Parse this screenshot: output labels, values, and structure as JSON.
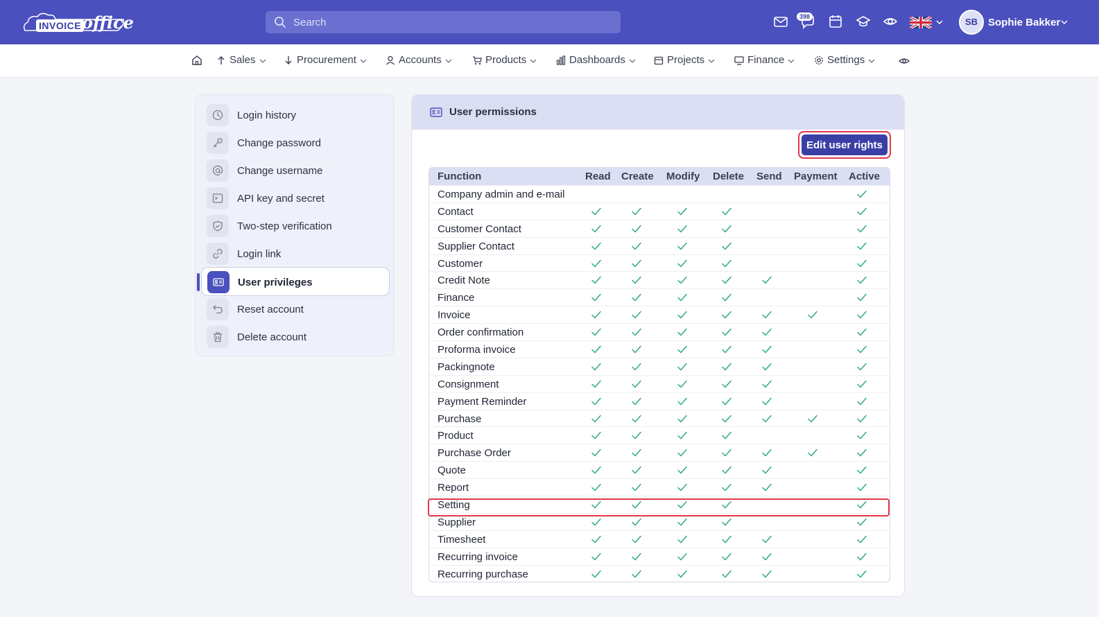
{
  "header": {
    "logo_text_box": "INVOICE",
    "logo_text_script": "office",
    "search_placeholder": "Search",
    "notification_count": "398",
    "user_initials": "SB",
    "user_name": "Sophie Bakker"
  },
  "nav": {
    "items": [
      {
        "label": "Sales"
      },
      {
        "label": "Procurement"
      },
      {
        "label": "Accounts"
      },
      {
        "label": "Products"
      },
      {
        "label": "Dashboards"
      },
      {
        "label": "Projects"
      },
      {
        "label": "Finance"
      },
      {
        "label": "Settings"
      }
    ]
  },
  "sidebar": {
    "items": [
      {
        "label": "Login history",
        "icon": "clock-icon"
      },
      {
        "label": "Change password",
        "icon": "key-icon"
      },
      {
        "label": "Change username",
        "icon": "at-icon"
      },
      {
        "label": "API key and secret",
        "icon": "terminal-icon"
      },
      {
        "label": "Two-step verification",
        "icon": "shield-icon"
      },
      {
        "label": "Login link",
        "icon": "link-icon"
      },
      {
        "label": "User privileges",
        "icon": "id-card-icon",
        "active": true
      },
      {
        "label": "Reset account",
        "icon": "undo-icon"
      },
      {
        "label": "Delete account",
        "icon": "trash-icon"
      }
    ]
  },
  "panel": {
    "title": "User permissions",
    "edit_button": "Edit user rights"
  },
  "table": {
    "columns": [
      "Function",
      "Read",
      "Create",
      "Modify",
      "Delete",
      "Send",
      "Payment",
      "Active"
    ],
    "highlighted_row": "Setting",
    "rows": [
      {
        "function": "Company admin and e-mail",
        "read": false,
        "create": false,
        "modify": false,
        "delete": false,
        "send": false,
        "payment": false,
        "active": true
      },
      {
        "function": "Contact",
        "read": true,
        "create": true,
        "modify": true,
        "delete": true,
        "send": false,
        "payment": false,
        "active": true
      },
      {
        "function": "Customer Contact",
        "read": true,
        "create": true,
        "modify": true,
        "delete": true,
        "send": false,
        "payment": false,
        "active": true
      },
      {
        "function": "Supplier Contact",
        "read": true,
        "create": true,
        "modify": true,
        "delete": true,
        "send": false,
        "payment": false,
        "active": true
      },
      {
        "function": "Customer",
        "read": true,
        "create": true,
        "modify": true,
        "delete": true,
        "send": false,
        "payment": false,
        "active": true
      },
      {
        "function": "Credit Note",
        "read": true,
        "create": true,
        "modify": true,
        "delete": true,
        "send": true,
        "payment": false,
        "active": true
      },
      {
        "function": "Finance",
        "read": true,
        "create": true,
        "modify": true,
        "delete": true,
        "send": false,
        "payment": false,
        "active": true
      },
      {
        "function": "Invoice",
        "read": true,
        "create": true,
        "modify": true,
        "delete": true,
        "send": true,
        "payment": true,
        "active": true
      },
      {
        "function": "Order confirmation",
        "read": true,
        "create": true,
        "modify": true,
        "delete": true,
        "send": true,
        "payment": false,
        "active": true
      },
      {
        "function": "Proforma invoice",
        "read": true,
        "create": true,
        "modify": true,
        "delete": true,
        "send": true,
        "payment": false,
        "active": true
      },
      {
        "function": "Packingnote",
        "read": true,
        "create": true,
        "modify": true,
        "delete": true,
        "send": true,
        "payment": false,
        "active": true
      },
      {
        "function": "Consignment",
        "read": true,
        "create": true,
        "modify": true,
        "delete": true,
        "send": true,
        "payment": false,
        "active": true
      },
      {
        "function": "Payment Reminder",
        "read": true,
        "create": true,
        "modify": true,
        "delete": true,
        "send": true,
        "payment": false,
        "active": true
      },
      {
        "function": "Purchase",
        "read": true,
        "create": true,
        "modify": true,
        "delete": true,
        "send": true,
        "payment": true,
        "active": true
      },
      {
        "function": "Product",
        "read": true,
        "create": true,
        "modify": true,
        "delete": true,
        "send": false,
        "payment": false,
        "active": true
      },
      {
        "function": "Purchase Order",
        "read": true,
        "create": true,
        "modify": true,
        "delete": true,
        "send": true,
        "payment": true,
        "active": true
      },
      {
        "function": "Quote",
        "read": true,
        "create": true,
        "modify": true,
        "delete": true,
        "send": true,
        "payment": false,
        "active": true
      },
      {
        "function": "Report",
        "read": true,
        "create": true,
        "modify": true,
        "delete": true,
        "send": true,
        "payment": false,
        "active": true
      },
      {
        "function": "Setting",
        "read": true,
        "create": true,
        "modify": true,
        "delete": true,
        "send": false,
        "payment": false,
        "active": true
      },
      {
        "function": "Supplier",
        "read": true,
        "create": true,
        "modify": true,
        "delete": true,
        "send": false,
        "payment": false,
        "active": true
      },
      {
        "function": "Timesheet",
        "read": true,
        "create": true,
        "modify": true,
        "delete": true,
        "send": true,
        "payment": false,
        "active": true
      },
      {
        "function": "Recurring invoice",
        "read": true,
        "create": true,
        "modify": true,
        "delete": true,
        "send": true,
        "payment": false,
        "active": true
      },
      {
        "function": "Recurring purchase",
        "read": true,
        "create": true,
        "modify": true,
        "delete": true,
        "send": true,
        "payment": false,
        "active": true
      }
    ]
  },
  "colors": {
    "brand": "#4a50bd",
    "brand_dark": "#3a3fa6",
    "check": "#2eaa83",
    "highlight": "#e0374a"
  }
}
